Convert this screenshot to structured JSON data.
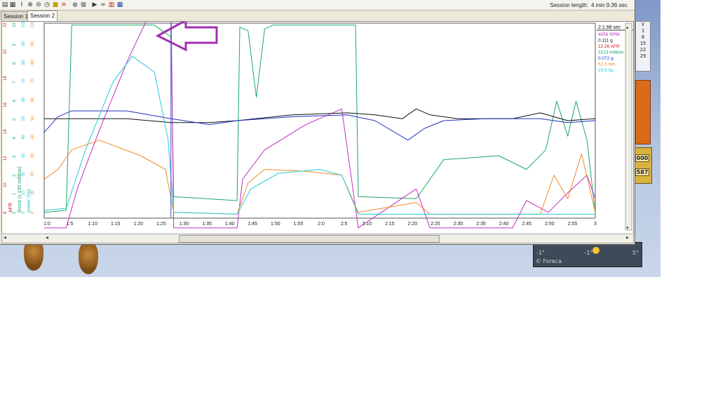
{
  "toolbar": {
    "session_length_label": "Session length:",
    "session_length_value": "4 min 9.36 sec",
    "icons": [
      "open-icon",
      "save-icon",
      "cursor-icon",
      "zoom-in-icon",
      "zoom-out-icon",
      "clock-icon",
      "note-icon",
      "overlay-icon",
      "record-icon",
      "stop-icon",
      "play-icon",
      "binoculars-icon",
      "histogram-icon",
      "table-icon"
    ]
  },
  "tabs": [
    {
      "label": "Session 1",
      "active": false
    },
    {
      "label": "Session 2",
      "active": true
    }
  ],
  "ticker": [
    "V",
    "1",
    "8",
    "15",
    "22",
    "29"
  ],
  "gold_widget": [
    "000",
    "587"
  ],
  "weather": {
    "temps": [
      "-1°",
      "-1°",
      "5°"
    ],
    "credit": "© Foreca"
  },
  "chart_data": {
    "type": "line",
    "x_tick_labels": [
      "1:0",
      "1:5",
      "1:10",
      "1:15",
      "1:20",
      "1:25",
      "1:30",
      "1:35",
      "1:40",
      "1:45",
      "1:50",
      "1:55",
      "2:0",
      "2:5",
      "2:10",
      "2:15",
      "2:20",
      "2:25",
      "2:30",
      "2:35",
      "2:40",
      "2:45",
      "2:50",
      "2:55",
      "3"
    ],
    "axes": [
      {
        "label": "AFR",
        "color": "#d01818",
        "ticks": [
          "22",
          "20",
          "18",
          "16",
          "14",
          "12",
          "10",
          "8"
        ]
      },
      {
        "label": "Boost (x 100 millibar)",
        "color": "#1aa86b",
        "ticks": [
          "10",
          "9",
          "8",
          "7",
          "6",
          "5",
          "4",
          "3",
          "2",
          "1",
          "0"
        ]
      },
      {
        "label": "power (hp)",
        "color": "#28c8d8",
        "ticks": [
          "100",
          "90",
          "80",
          "70",
          "60",
          "50",
          "40",
          "30",
          "20",
          "10",
          "0"
        ]
      },
      {
        "label": "",
        "color": "#f08a2a",
        "ticks": [
          "100",
          "90",
          "80",
          "70",
          "60",
          "50",
          "40",
          "30",
          "20",
          "10",
          "0"
        ]
      }
    ],
    "readout": {
      "time": "2:1.98 sec",
      "rows": [
        {
          "text": "4056 RPM",
          "color": "#c030c0"
        },
        {
          "text": "0.111 g",
          "color": "#111111"
        },
        {
          "text": "12.26 AFR",
          "color": "#d01818"
        },
        {
          "text": "1013 millibar",
          "color": "#1aa86b"
        },
        {
          "text": "0.072 g",
          "color": "#2030c0"
        },
        {
          "text": "52.3 Nm",
          "color": "#f08a2a"
        },
        {
          "text": "29.9 hp",
          "color": "#28c8d8"
        }
      ]
    },
    "series": [
      {
        "color": "#1aa86b",
        "values": [
          [
            1.0,
            0.3
          ],
          [
            1.08,
            0.4
          ],
          [
            1.1,
            9.9
          ],
          [
            1.4,
            9.9
          ],
          [
            1.46,
            9.3
          ],
          [
            1.47,
            1.1
          ],
          [
            1.7,
            0.9
          ],
          [
            1.71,
            9.8
          ],
          [
            1.74,
            9.6
          ],
          [
            1.77,
            6.2
          ],
          [
            1.8,
            9.7
          ],
          [
            1.83,
            9.9
          ],
          [
            2.13,
            9.9
          ],
          [
            2.14,
            1.1
          ],
          [
            2.35,
            1.0
          ],
          [
            2.45,
            3.0
          ],
          [
            2.65,
            3.2
          ],
          [
            2.75,
            2.5
          ],
          [
            2.82,
            3.5
          ],
          [
            2.86,
            6.0
          ],
          [
            2.9,
            4.2
          ],
          [
            2.93,
            6.0
          ],
          [
            2.97,
            4.0
          ],
          [
            3.0,
            0.2
          ]
        ]
      },
      {
        "color": "#d01818",
        "values": [
          [
            1.0,
            15.5
          ],
          [
            1.05,
            16.5
          ],
          [
            1.1,
            13.5
          ],
          [
            1.2,
            12.0
          ],
          [
            1.3,
            11.5
          ],
          [
            1.38,
            11.0
          ],
          [
            1.46,
            22.5
          ],
          [
            1.7,
            22.5
          ],
          [
            1.71,
            14.5
          ],
          [
            1.76,
            15.2
          ],
          [
            1.83,
            14.0
          ],
          [
            2.08,
            12.5
          ],
          [
            2.14,
            22.5
          ],
          [
            2.33,
            22.5
          ],
          [
            2.34,
            14.8
          ],
          [
            2.42,
            14.9
          ],
          [
            2.48,
            15.0
          ],
          [
            2.55,
            14.4
          ],
          [
            2.62,
            15.3
          ],
          [
            2.7,
            14.8
          ],
          [
            2.8,
            16.0
          ],
          [
            2.85,
            14.5
          ],
          [
            2.9,
            15.5
          ],
          [
            2.95,
            14.8
          ],
          [
            3.0,
            20.0
          ]
        ]
      },
      {
        "color": "#c030c0",
        "values": [
          [
            1.0,
            -0.5
          ],
          [
            1.08,
            -0.5
          ],
          [
            1.12,
            1.5
          ],
          [
            1.2,
            4.5
          ],
          [
            1.3,
            8.0
          ],
          [
            1.4,
            11.0
          ],
          [
            1.46,
            11.5
          ],
          [
            1.47,
            -0.5
          ],
          [
            1.7,
            -0.5
          ],
          [
            1.72,
            2.0
          ],
          [
            1.8,
            3.5
          ],
          [
            1.95,
            4.8
          ],
          [
            2.08,
            5.6
          ],
          [
            2.14,
            -0.5
          ],
          [
            2.35,
            1.5
          ],
          [
            2.4,
            -0.5
          ],
          [
            2.7,
            -0.5
          ],
          [
            2.75,
            0.9
          ],
          [
            2.83,
            0.3
          ],
          [
            2.9,
            1.3
          ],
          [
            2.97,
            2.2
          ],
          [
            3.0,
            1.0
          ]
        ]
      },
      {
        "color": "#111111",
        "values": [
          [
            1.0,
            5.1
          ],
          [
            1.1,
            5.1
          ],
          [
            1.3,
            5.1
          ],
          [
            1.46,
            4.9
          ],
          [
            1.6,
            4.9
          ],
          [
            1.7,
            5.0
          ],
          [
            1.9,
            5.3
          ],
          [
            2.1,
            5.4
          ],
          [
            2.2,
            5.3
          ],
          [
            2.3,
            5.1
          ],
          [
            2.35,
            5.6
          ],
          [
            2.4,
            5.3
          ],
          [
            2.5,
            5.1
          ],
          [
            2.7,
            5.1
          ],
          [
            2.8,
            5.4
          ],
          [
            2.9,
            5.0
          ],
          [
            3.0,
            5.1
          ]
        ]
      },
      {
        "color": "#2030c0",
        "values": [
          [
            1.0,
            4.4
          ],
          [
            1.05,
            5.2
          ],
          [
            1.1,
            5.5
          ],
          [
            1.3,
            5.5
          ],
          [
            1.46,
            5.1
          ],
          [
            1.6,
            4.8
          ],
          [
            1.7,
            5.0
          ],
          [
            1.9,
            5.2
          ],
          [
            2.1,
            5.3
          ],
          [
            2.2,
            5.0
          ],
          [
            2.32,
            4.0
          ],
          [
            2.38,
            4.6
          ],
          [
            2.45,
            5.0
          ],
          [
            2.6,
            5.1
          ],
          [
            2.8,
            5.1
          ],
          [
            2.9,
            4.9
          ],
          [
            3.0,
            5.0
          ]
        ]
      },
      {
        "color": "#f08a2a",
        "values": [
          [
            1.0,
            2.0
          ],
          [
            1.05,
            2.5
          ],
          [
            1.1,
            3.5
          ],
          [
            1.2,
            4.0
          ],
          [
            1.35,
            3.2
          ],
          [
            1.44,
            2.5
          ],
          [
            1.47,
            0.3
          ],
          [
            1.7,
            0.2
          ],
          [
            1.74,
            1.8
          ],
          [
            1.8,
            2.5
          ],
          [
            1.95,
            2.4
          ],
          [
            2.08,
            2.2
          ],
          [
            2.14,
            0.3
          ],
          [
            2.35,
            0.8
          ],
          [
            2.4,
            0.2
          ],
          [
            2.8,
            0.2
          ],
          [
            2.85,
            2.2
          ],
          [
            2.9,
            1.0
          ],
          [
            2.95,
            3.3
          ],
          [
            3.0,
            0.3
          ]
        ]
      },
      {
        "color": "#28c8d8",
        "values": [
          [
            1.0,
            0.4
          ],
          [
            1.08,
            0.5
          ],
          [
            1.15,
            3.5
          ],
          [
            1.25,
            7.0
          ],
          [
            1.32,
            8.3
          ],
          [
            1.4,
            7.5
          ],
          [
            1.45,
            4.0
          ],
          [
            1.47,
            0.3
          ],
          [
            1.7,
            0.2
          ],
          [
            1.75,
            1.5
          ],
          [
            1.85,
            2.3
          ],
          [
            2.0,
            2.5
          ],
          [
            2.08,
            2.2
          ],
          [
            2.14,
            0.2
          ],
          [
            2.8,
            0.2
          ],
          [
            2.9,
            0.2
          ],
          [
            3.0,
            0.2
          ]
        ]
      }
    ],
    "x_range": [
      1.0,
      3.0
    ],
    "y_range": [
      0,
      10
    ],
    "annotation": "arrow pointing to magenta trace near 1:23"
  }
}
